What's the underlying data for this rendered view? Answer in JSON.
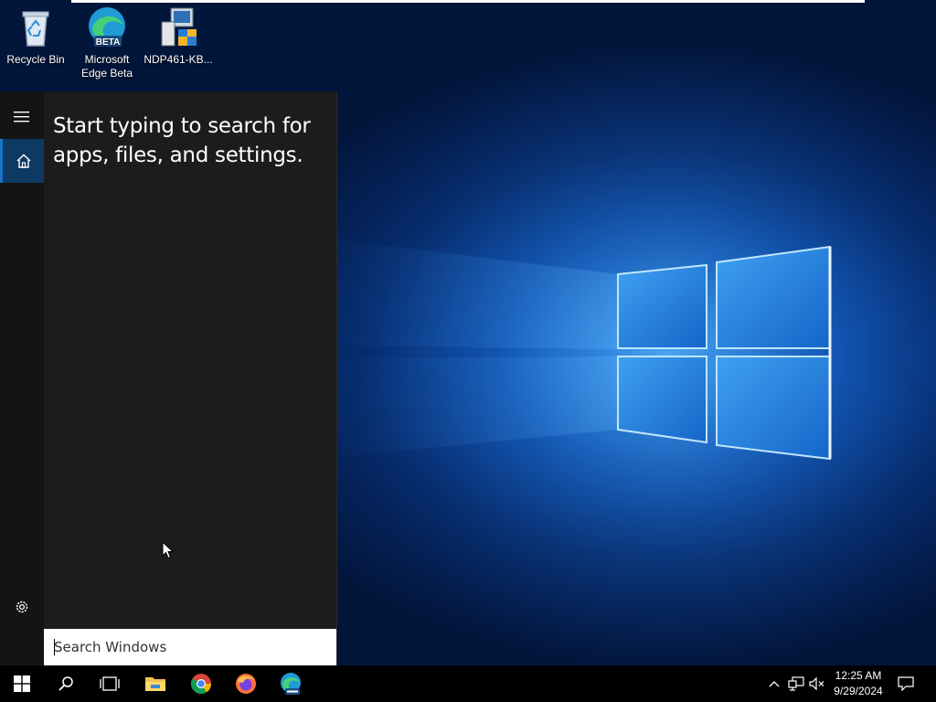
{
  "desktop": {
    "icons": [
      {
        "label": "Recycle Bin",
        "icon": "recycle-bin-icon"
      },
      {
        "label": "Microsoft\nEdge Beta",
        "line1": "Microsoft",
        "line2": "Edge Beta",
        "icon": "edge-beta-icon",
        "badge": "BETA"
      },
      {
        "label": "NDP461-KB...",
        "icon": "installer-icon"
      }
    ]
  },
  "start": {
    "hint": "Start typing to search for apps, files, and settings.",
    "rail": {
      "menu_icon": "hamburger-icon",
      "home_icon": "home-icon",
      "settings_icon": "gear-icon"
    },
    "search": {
      "placeholder": "Search Windows",
      "value": ""
    }
  },
  "taskbar": {
    "apps": [
      {
        "name": "start",
        "icon": "windows-logo-icon"
      },
      {
        "name": "search",
        "icon": "search-icon"
      },
      {
        "name": "task-view",
        "icon": "task-view-icon"
      },
      {
        "name": "file-explorer",
        "icon": "folder-icon"
      },
      {
        "name": "chrome",
        "icon": "chrome-icon"
      },
      {
        "name": "firefox",
        "icon": "firefox-icon"
      },
      {
        "name": "edge-beta",
        "icon": "edge-beta-icon"
      }
    ],
    "tray": {
      "chevron_icon": "chevron-up-icon",
      "network_icon": "network-icon",
      "volume_icon": "volume-muted-icon",
      "time": "12:25 AM",
      "date": "9/29/2024",
      "notification_icon": "notification-icon"
    }
  },
  "colors": {
    "accent": "#0d3a63",
    "panel": "#1c1c1c",
    "taskbar": "#000000"
  }
}
